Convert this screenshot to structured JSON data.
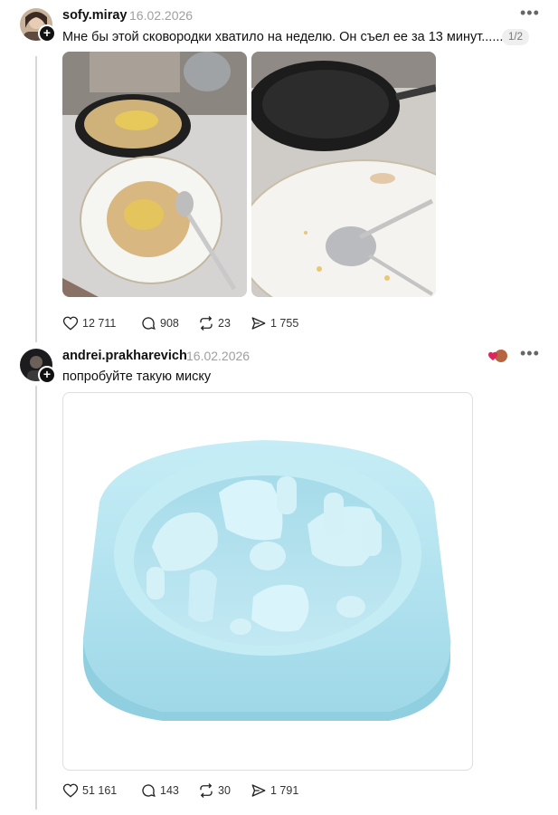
{
  "posts": [
    {
      "username": "sofy.miray",
      "date": "16.02.2026",
      "text": "Мне бы этой сковородки хватило на неделю. Он съел ее за 13 минут......",
      "pager": "1/2",
      "images": [
        "photo-pan-with-food",
        "photo-empty-pan"
      ],
      "stats": {
        "likes": "12 711",
        "replies": "908",
        "reposts": "23",
        "shares": "1 755"
      }
    },
    {
      "username": "andrei.prakharevich",
      "date": "16.02.2026",
      "text": "попробуйте такую миску",
      "images": [
        "photo-slow-feeder-bowl"
      ],
      "stats": {
        "likes": "51 161",
        "replies": "143",
        "reposts": "30",
        "shares": "1 791"
      }
    }
  ],
  "icons": {
    "like": "heart-icon",
    "reply": "comment-icon",
    "repost": "repost-icon",
    "share": "share-icon",
    "more": "more-icon",
    "follow": "plus-icon",
    "reaction": "liked-by-author-icon"
  },
  "colors": {
    "bowl": "#b9e7f2",
    "bowl_shadow": "#8fd0e1",
    "accent_heart": "#e0245e"
  }
}
